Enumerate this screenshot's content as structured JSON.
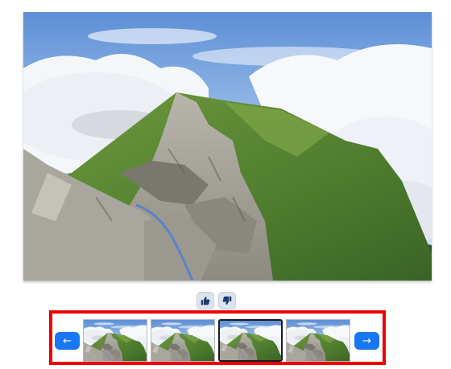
{
  "gallery": {
    "main_image": {
      "icon": "mountain-ridge-photo",
      "alt": ""
    },
    "vote": {
      "like_icon": "thumbs-up-icon",
      "dislike_icon": "thumbs-down-icon"
    },
    "nav": {
      "prev_glyph": "←",
      "next_glyph": "→"
    },
    "thumbnails": [
      {
        "selected": false
      },
      {
        "selected": false
      },
      {
        "selected": true
      },
      {
        "selected": false
      }
    ],
    "colors": {
      "accent": "#1877f2",
      "highlight_border": "#ee0000",
      "vote_bg": "#dbe3ef"
    }
  }
}
